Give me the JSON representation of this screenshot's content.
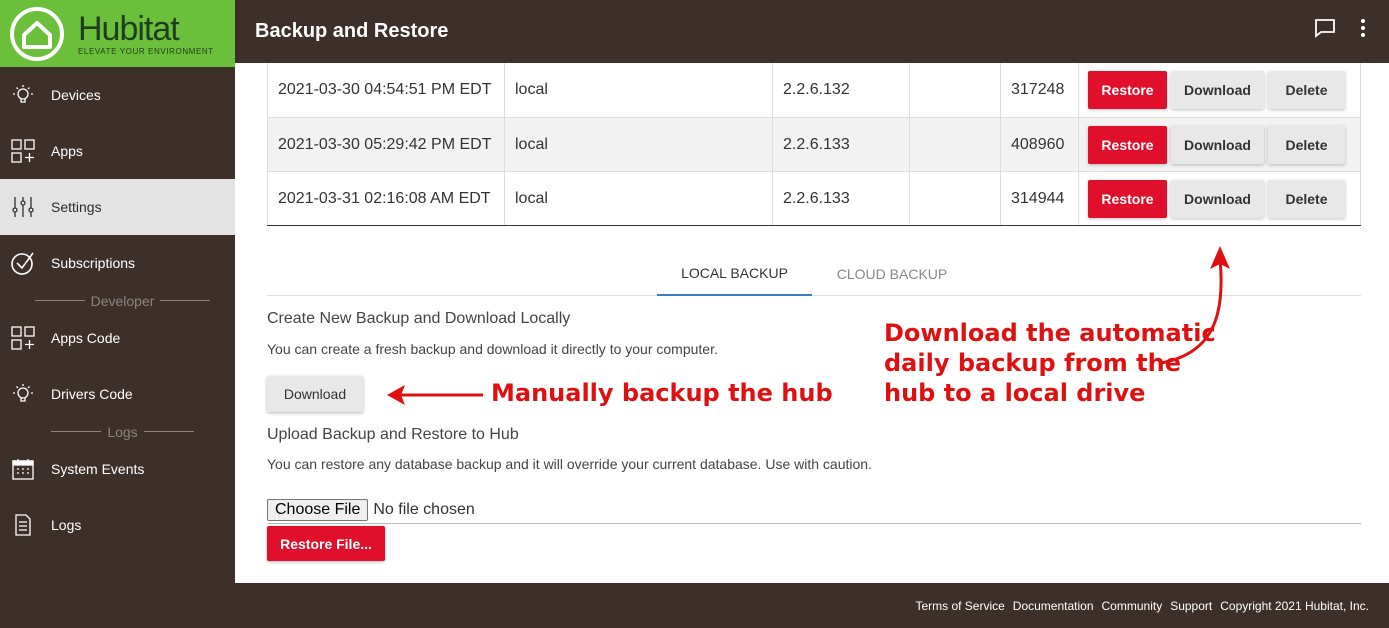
{
  "brand": {
    "name": "Hubitat",
    "tagline": "ELEVATE YOUR ENVIRONMENT"
  },
  "header": {
    "title": "Backup and Restore"
  },
  "sidebar": {
    "items": [
      {
        "label": "Devices",
        "icon": "lightbulb-icon"
      },
      {
        "label": "Apps",
        "icon": "apps-grid-icon"
      },
      {
        "label": "Settings",
        "icon": "sliders-icon"
      },
      {
        "label": "Subscriptions",
        "icon": "check-circle-icon"
      },
      {
        "label": "Apps Code",
        "icon": "apps-grid-icon"
      },
      {
        "label": "Drivers Code",
        "icon": "lightbulb-icon"
      },
      {
        "label": "System Events",
        "icon": "calendar-icon"
      },
      {
        "label": "Logs",
        "icon": "document-icon"
      }
    ],
    "sections": {
      "developer": "Developer",
      "logs": "Logs"
    }
  },
  "backups": {
    "rows": [
      {
        "date": "2021-03-30 04:54:51 PM EDT",
        "location": "local",
        "version": "2.2.6.132",
        "extra": "",
        "size": "317248"
      },
      {
        "date": "2021-03-30 05:29:42 PM EDT",
        "location": "local",
        "version": "2.2.6.133",
        "extra": "",
        "size": "408960"
      },
      {
        "date": "2021-03-31 02:16:08 AM EDT",
        "location": "local",
        "version": "2.2.6.133",
        "extra": "",
        "size": "314944"
      }
    ],
    "restore_label": "Restore",
    "download_label": "Download",
    "delete_label": "Delete"
  },
  "tabs": {
    "local": "LOCAL BACKUP",
    "cloud": "CLOUD BACKUP"
  },
  "create": {
    "title": "Create New Backup and Download Locally",
    "desc": "You can create a fresh backup and download it directly to your computer.",
    "button": "Download"
  },
  "upload": {
    "title": "Upload Backup and Restore to Hub",
    "desc": "You can restore any database backup and it will override your current database. Use with caution.",
    "choose": "Choose File",
    "status": "No file chosen",
    "button": "Restore File..."
  },
  "annotations": {
    "manual": "Manually backup the hub",
    "auto_1": "Download the automatic",
    "auto_2": "daily backup from the",
    "auto_3": "hub to a local drive"
  },
  "footer": {
    "links": [
      "Terms of Service",
      "Documentation",
      "Community",
      "Support"
    ],
    "copyright": "Copyright 2021 Hubitat, Inc."
  },
  "colors": {
    "accent_red": "#e0102c",
    "brand_green": "#6bbf3b",
    "dark": "#3d2f2a",
    "tab_underline": "#3b7dbd"
  }
}
